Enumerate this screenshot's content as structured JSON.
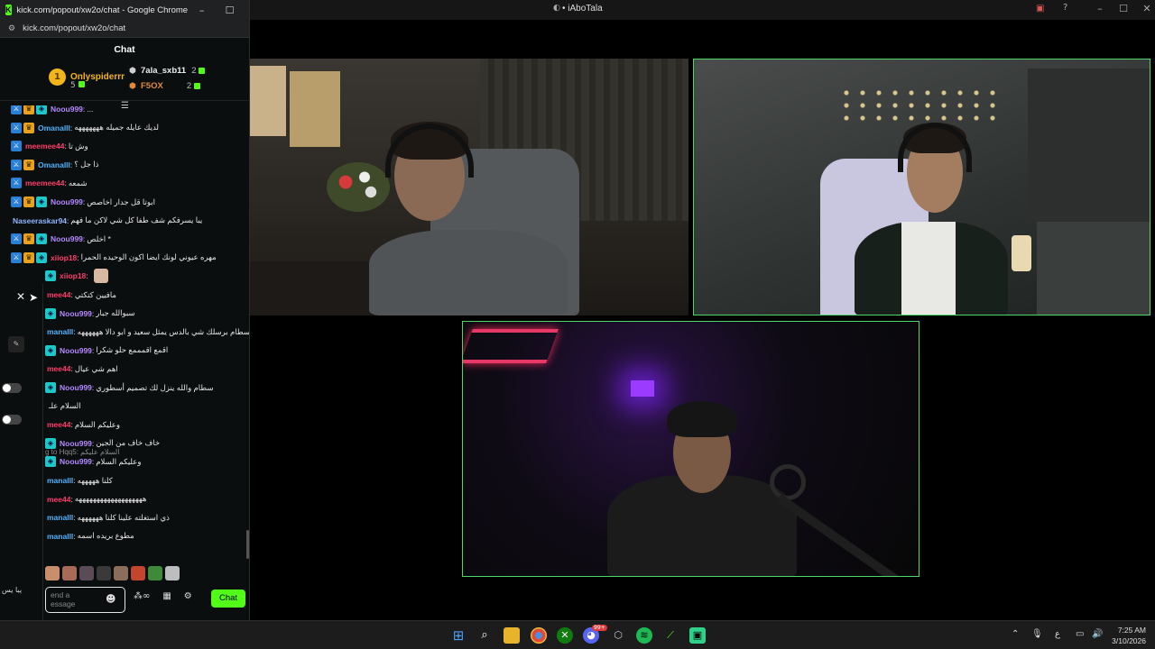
{
  "background_window": {
    "title": "• iAboTala",
    "controls": [
      "–",
      "☐",
      "✕"
    ]
  },
  "chrome": {
    "title": "kick.com/popout/xw2o/chat - Google Chrome",
    "url": "kick.com/popout/xw2o/chat",
    "controls": [
      "–",
      "☐",
      "✕"
    ]
  },
  "chat": {
    "header": "Chat",
    "leaderboard": {
      "first": {
        "rank": "1",
        "name": "Onlyspiderrr",
        "count": "5"
      },
      "second": {
        "name": "7ala_sxb11",
        "count": "2"
      },
      "third": {
        "name": "F5OX",
        "count": "2"
      }
    },
    "messages": [
      {
        "badges": [
          "mod",
          "vip",
          "sub"
        ],
        "user": "Noou999",
        "color": "#b388ff",
        "text": "..."
      },
      {
        "badges": [
          "mod",
          "vip"
        ],
        "user": "Omanalll",
        "color": "#4fb3ff",
        "text": "لديك عايله جميله هههههههه"
      },
      {
        "badges": [
          "mod"
        ],
        "user": "meemee44",
        "color": "#ff3b6b",
        "text": "وش تا"
      },
      {
        "badges": [
          "mod",
          "vip"
        ],
        "user": "Omanalll",
        "color": "#4fb3ff",
        "text": "ذا جل ؟"
      },
      {
        "badges": [
          "mod"
        ],
        "user": "meemee44",
        "color": "#ff3b6b",
        "text": "شمعه"
      },
      {
        "badges": [
          "mod",
          "vip",
          "sub"
        ],
        "user": "Noou999",
        "color": "#b388ff",
        "text": "ابوتا قل جدار اخاصص"
      },
      {
        "badges": [],
        "user": "Naseeraskar94",
        "color": "#8fb4ff",
        "text": "يبا يسرفكم شف طفا كل شي لاكن ما فهم"
      },
      {
        "badges": [
          "mod",
          "vip",
          "sub"
        ],
        "user": "Noou999",
        "color": "#b388ff",
        "text": "اخلص *"
      },
      {
        "badges": [
          "mod",
          "vip",
          "sub"
        ],
        "user": "xiiop18",
        "color": "#ff3b6b",
        "text": "مهره عيوني لونك ايضا اكون الوحيده الحمرا"
      },
      {
        "badges": [
          "sub"
        ],
        "user": "xiiop18",
        "color": "#ff3b6b",
        "text": ""
      },
      {
        "badges": [],
        "user": "mee44",
        "color": "#ff3b6b",
        "text": "مافيين كتكتي"
      },
      {
        "badges": [
          "sub"
        ],
        "user": "Noou999",
        "color": "#b388ff",
        "text": "سبوالله جبار"
      },
      {
        "badges": [],
        "user": "manalll",
        "color": "#4fb3ff",
        "text": "سطام برسلك شي بالدس يمثل سعيد و ابو دالا ههههههه"
      },
      {
        "badges": [
          "sub"
        ],
        "user": "Noou999",
        "color": "#b388ff",
        "text": "اقمع اقمممع حلو شكرا"
      },
      {
        "badges": [],
        "user": "mee44",
        "color": "#ff3b6b",
        "text": "اهم شي عيال"
      },
      {
        "badges": [
          "sub"
        ],
        "user": "Noou999",
        "color": "#b388ff",
        "text": "سطام والله ينزل لك تصميم أسطوري"
      },
      {
        "badges": [],
        "user": "",
        "color": "#ddd",
        "text": "السلام علـ"
      },
      {
        "badges": [],
        "user": "mee44",
        "color": "#ff3b6b",
        "text": "وعليكم السلام"
      },
      {
        "badges": [
          "sub"
        ],
        "user": "Noou999",
        "color": "#b388ff",
        "text": "خاف خاف من الجين"
      },
      {
        "badges": [
          "sub"
        ],
        "user": "Noou999",
        "color": "#b388ff",
        "text": "وعليكم السلام"
      },
      {
        "badges": [],
        "user": "manalll",
        "color": "#4fb3ff",
        "text": "كلنا هههههه"
      },
      {
        "badges": [],
        "user": "mee44",
        "color": "#ff3b6b",
        "text": "هههههههههههههههههههه"
      },
      {
        "badges": [],
        "user": "manalll",
        "color": "#4fb3ff",
        "text": "ذي استغلته علينا كلنا ههههههه"
      },
      {
        "badges": [],
        "user": "manalll",
        "color": "#4fb3ff",
        "text": "مطوع بريده اسمه"
      }
    ],
    "reply_line": "g to Hqq5: السلام عليكم",
    "input_placeholder": "end a\nessage",
    "send_label": "Chat",
    "panel_text": "يبا يس"
  },
  "taskbar": {
    "time": "7:25 AM",
    "date": "3/10/2026",
    "lang": "ع",
    "discord_badge": "99+"
  }
}
